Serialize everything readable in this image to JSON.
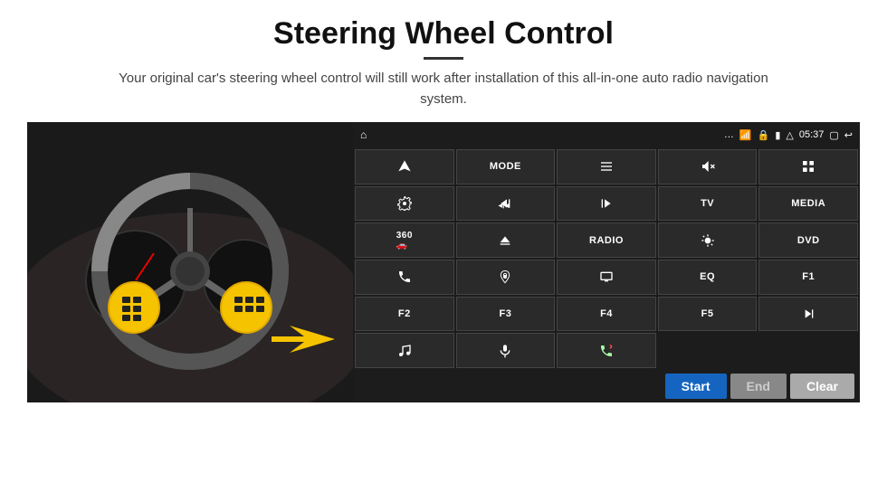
{
  "header": {
    "title": "Steering Wheel Control",
    "subtitle": "Your original car's steering wheel control will still work after installation of this all-in-one auto radio navigation system."
  },
  "statusBar": {
    "time": "05:37",
    "icons": [
      "home",
      "wifi",
      "lock",
      "sim",
      "bluetooth",
      "window",
      "back"
    ]
  },
  "buttons": [
    {
      "id": "r1c1",
      "type": "icon",
      "icon": "navigate",
      "label": "navigate"
    },
    {
      "id": "r1c2",
      "type": "text",
      "label": "MODE"
    },
    {
      "id": "r1c3",
      "type": "icon",
      "icon": "list",
      "label": "list"
    },
    {
      "id": "r1c4",
      "type": "icon",
      "icon": "mute",
      "label": "mute"
    },
    {
      "id": "r1c5",
      "type": "icon",
      "icon": "apps",
      "label": "apps"
    },
    {
      "id": "r2c1",
      "type": "icon",
      "icon": "settings",
      "label": "settings"
    },
    {
      "id": "r2c2",
      "type": "icon",
      "icon": "prev",
      "label": "prev"
    },
    {
      "id": "r2c3",
      "type": "icon",
      "icon": "next",
      "label": "next"
    },
    {
      "id": "r2c4",
      "type": "text",
      "label": "TV"
    },
    {
      "id": "r2c5",
      "type": "text",
      "label": "MEDIA"
    },
    {
      "id": "r3c1",
      "type": "icon",
      "icon": "360cam",
      "label": "360"
    },
    {
      "id": "r3c2",
      "type": "icon",
      "icon": "eject",
      "label": "eject"
    },
    {
      "id": "r3c3",
      "type": "text",
      "label": "RADIO"
    },
    {
      "id": "r3c4",
      "type": "icon",
      "icon": "brightness",
      "label": "brightness"
    },
    {
      "id": "r3c5",
      "type": "text",
      "label": "DVD"
    },
    {
      "id": "r4c1",
      "type": "icon",
      "icon": "phone",
      "label": "phone"
    },
    {
      "id": "r4c2",
      "type": "icon",
      "icon": "gps",
      "label": "gps"
    },
    {
      "id": "r4c3",
      "type": "icon",
      "icon": "screen",
      "label": "screen"
    },
    {
      "id": "r4c4",
      "type": "text",
      "label": "EQ"
    },
    {
      "id": "r4c5",
      "type": "text",
      "label": "F1"
    },
    {
      "id": "r5c1",
      "type": "text",
      "label": "F2"
    },
    {
      "id": "r5c2",
      "type": "text",
      "label": "F3"
    },
    {
      "id": "r5c3",
      "type": "text",
      "label": "F4"
    },
    {
      "id": "r5c4",
      "type": "text",
      "label": "F5"
    },
    {
      "id": "r5c5",
      "type": "icon",
      "icon": "playpause",
      "label": "playpause"
    },
    {
      "id": "r6c1",
      "type": "icon",
      "icon": "music",
      "label": "music"
    },
    {
      "id": "r6c2",
      "type": "icon",
      "icon": "mic",
      "label": "mic"
    },
    {
      "id": "r6c3",
      "type": "icon",
      "icon": "call",
      "label": "call"
    },
    {
      "id": "r6c4",
      "type": "empty",
      "label": ""
    },
    {
      "id": "r6c5",
      "type": "empty",
      "label": ""
    }
  ],
  "actionBar": {
    "start_label": "Start",
    "end_label": "End",
    "clear_label": "Clear"
  }
}
